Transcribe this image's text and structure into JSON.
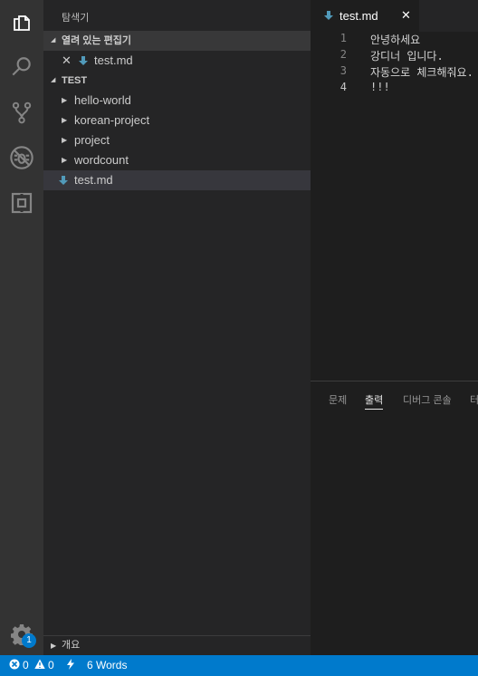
{
  "sidebar": {
    "title": "탐색기",
    "open_editors": {
      "label": "열려 있는 편집기",
      "items": [
        {
          "label": "test.md"
        }
      ]
    },
    "folder": {
      "label": "TEST",
      "items": [
        {
          "label": "hello-world"
        },
        {
          "label": "korean-project"
        },
        {
          "label": "project"
        },
        {
          "label": "wordcount"
        },
        {
          "label": "test.md"
        }
      ]
    },
    "outline_label": "개요"
  },
  "editor": {
    "tab_label": "test.md",
    "close_glyph": "✕",
    "line_numbers": [
      "1",
      "2",
      "3",
      "4"
    ],
    "lines": [
      "안녕하세요",
      "강디너 입니다.",
      "자동으로 체크해줘요.",
      "!!!"
    ]
  },
  "panel": {
    "tabs": [
      "문제",
      "출력",
      "디버그 콘솔",
      "터"
    ]
  },
  "activity": {
    "badge": "1",
    "icons": [
      "files-icon",
      "search-icon",
      "source-control-icon",
      "debug-icon",
      "extensions-icon",
      "gear-icon"
    ]
  },
  "status": {
    "errors": "0",
    "warnings": "0",
    "words": "6 Words"
  },
  "colors": {
    "accent": "#007acc",
    "markdown_icon": "#519aba"
  }
}
